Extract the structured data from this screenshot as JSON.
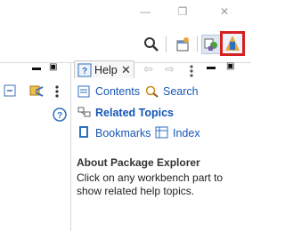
{
  "window_controls": {
    "minimize": "—",
    "restore": "❐",
    "close": "✕"
  },
  "help_view": {
    "tab_label": "Help",
    "links": {
      "contents": "Contents",
      "search": "Search",
      "related_topics": "Related Topics",
      "bookmarks": "Bookmarks",
      "index": "Index"
    },
    "section_title": "About Package Explorer",
    "description": "Click on any workbench part to show related help topics."
  },
  "icons": {
    "search": "magnifier-icon",
    "open_perspective": "open-perspective-icon",
    "java_perspective": "java-perspective-icon",
    "debug_perspective": "debug-perspective-icon",
    "collapse": "collapse-all-icon",
    "link": "link-editor-icon",
    "view_menu": "view-menu-icon",
    "help": "help-icon",
    "nav_back": "back-icon",
    "nav_forward": "forward-icon",
    "minimize": "minimize-view-icon",
    "maximize": "maximize-view-icon",
    "contents": "contents-icon",
    "search_link": "search-help-icon",
    "related": "related-topics-icon",
    "bookmarks": "bookmarks-icon",
    "index": "index-icon"
  },
  "colors": {
    "highlight_border": "#d42020",
    "link": "#1656b6"
  }
}
